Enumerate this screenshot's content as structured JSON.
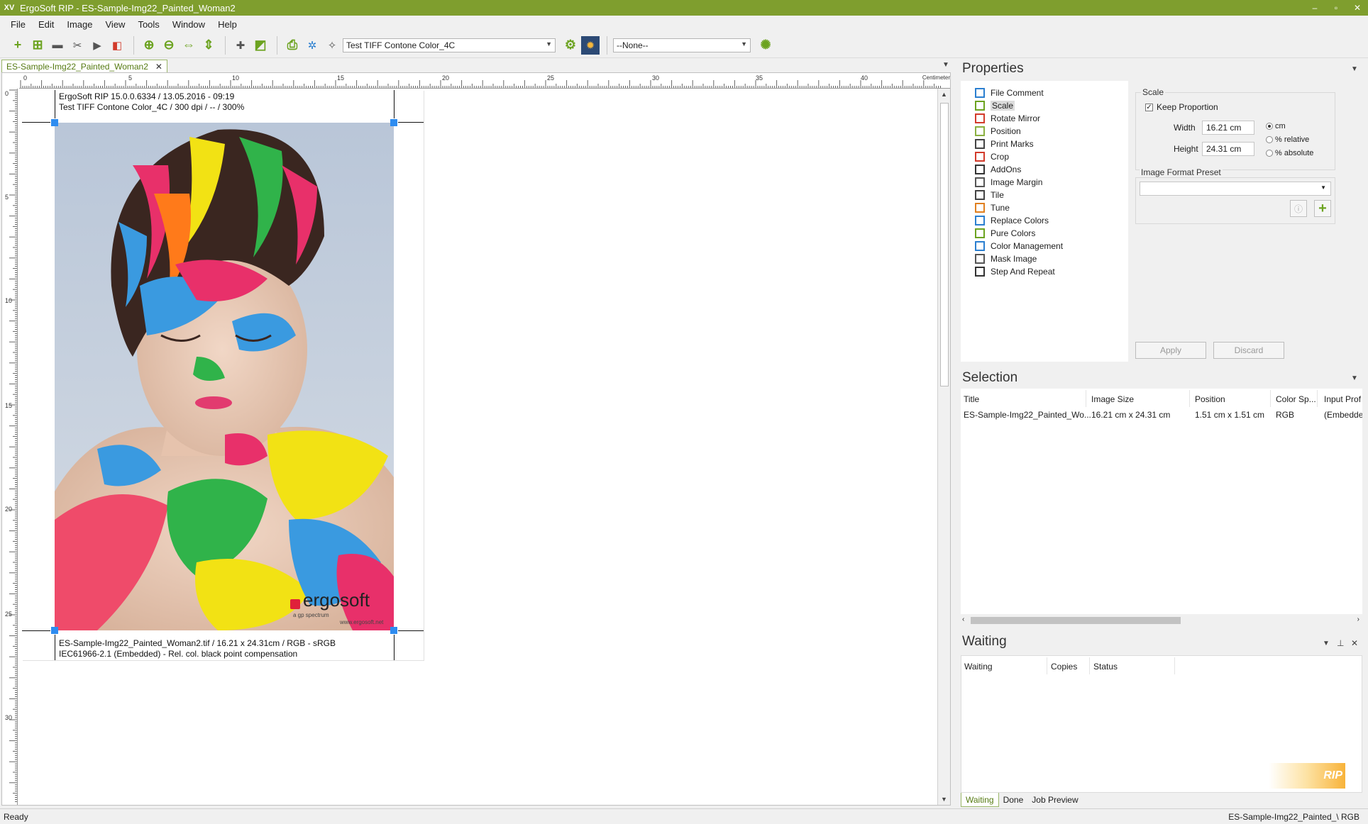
{
  "window": {
    "title": "ErgoSoft RIP - ES-Sample-Img22_Painted_Woman2",
    "logo": "XV",
    "controls": [
      "–",
      "▫",
      "✕"
    ]
  },
  "menu": [
    "File",
    "Edit",
    "Image",
    "View",
    "Tools",
    "Window",
    "Help"
  ],
  "toolbar": {
    "print_environment": "Test TIFF Contone Color_4C",
    "queue_select": "--None--"
  },
  "document": {
    "tab_label": "ES-Sample-Img22_Painted_Woman2",
    "ruler_unit": "Centimeter",
    "ruler_top_numbers": [
      "0",
      "5",
      "10",
      "15",
      "20",
      "25",
      "30",
      "35",
      "40"
    ],
    "ruler_left_numbers": [
      "0",
      "5",
      "10",
      "15",
      "20",
      "25",
      "30"
    ],
    "header_line1": "ErgoSoft RIP 15.0.0.6334 / 13.05.2016 - 09:19",
    "header_line2": "Test TIFF Contone Color_4C / 300 dpi / -- / 300%",
    "footer_line1": "ES-Sample-Img22_Painted_Woman2.tif / 16.21 x 24.31cm / RGB - sRGB",
    "footer_line2": "IEC61966-2.1 (Embedded) - Rel. col. black point compensation",
    "watermark_brand": "ergosoft",
    "watermark_sub": "a gp spectrum",
    "watermark_url": "www.ergosoft.net"
  },
  "properties": {
    "title": "Properties",
    "tree": [
      {
        "label": "File Comment",
        "icon": "comment-icon",
        "color": "#2b7fd0"
      },
      {
        "label": "Scale",
        "icon": "scale-icon",
        "color": "#6ca320",
        "selected": true
      },
      {
        "label": "Rotate Mirror",
        "icon": "rotate-icon",
        "color": "#d23b2b"
      },
      {
        "label": "Position",
        "icon": "position-icon",
        "color": "#8ab040"
      },
      {
        "label": "Print Marks",
        "icon": "print-marks-icon",
        "color": "#444444"
      },
      {
        "label": "Crop",
        "icon": "crop-icon",
        "color": "#d23b2b"
      },
      {
        "label": "AddOns",
        "icon": "addons-icon",
        "color": "#333333"
      },
      {
        "label": "Image Margin",
        "icon": "margin-icon",
        "color": "#555555"
      },
      {
        "label": "Tile",
        "icon": "tile-icon",
        "color": "#444444"
      },
      {
        "label": "Tune",
        "icon": "tune-icon",
        "color": "#e08020"
      },
      {
        "label": "Replace Colors",
        "icon": "replace-colors-icon",
        "color": "#2b7fd0"
      },
      {
        "label": "Pure Colors",
        "icon": "pure-colors-icon",
        "color": "#6ca320"
      },
      {
        "label": "Color Management",
        "icon": "color-management-icon",
        "color": "#2b7fd0"
      },
      {
        "label": "Mask Image",
        "icon": "mask-icon",
        "color": "#555555"
      },
      {
        "label": "Step And Repeat",
        "icon": "step-repeat-icon",
        "color": "#333333"
      }
    ],
    "scale": {
      "group_title": "Scale",
      "keep_proportion": "Keep Proportion",
      "width_label": "Width",
      "width_value": "16.21 cm",
      "height_label": "Height",
      "height_value": "24.31 cm",
      "unit_options": [
        "cm",
        "% relative",
        "% absolute"
      ],
      "preset_title": "Image Format Preset",
      "preset_value": ""
    },
    "apply_label": "Apply",
    "discard_label": "Discard"
  },
  "selection": {
    "title": "Selection",
    "columns": [
      "Title",
      "Image Size",
      "Position",
      "Color Sp...",
      "Input Prof"
    ],
    "row": [
      "ES-Sample-Img22_Painted_Wo...",
      "16.21 cm x 24.31 cm",
      "1.51 cm x 1.51 cm",
      "RGB",
      "(Embedde"
    ]
  },
  "waiting": {
    "title": "Waiting",
    "columns": [
      "Waiting",
      "Copies",
      "Status"
    ],
    "tabs": [
      "Waiting",
      "Done",
      "Job Preview"
    ],
    "rip_label": "RIP"
  },
  "status": {
    "left": "Ready",
    "right": "ES-Sample-Img22_Painted_\\  RGB"
  }
}
